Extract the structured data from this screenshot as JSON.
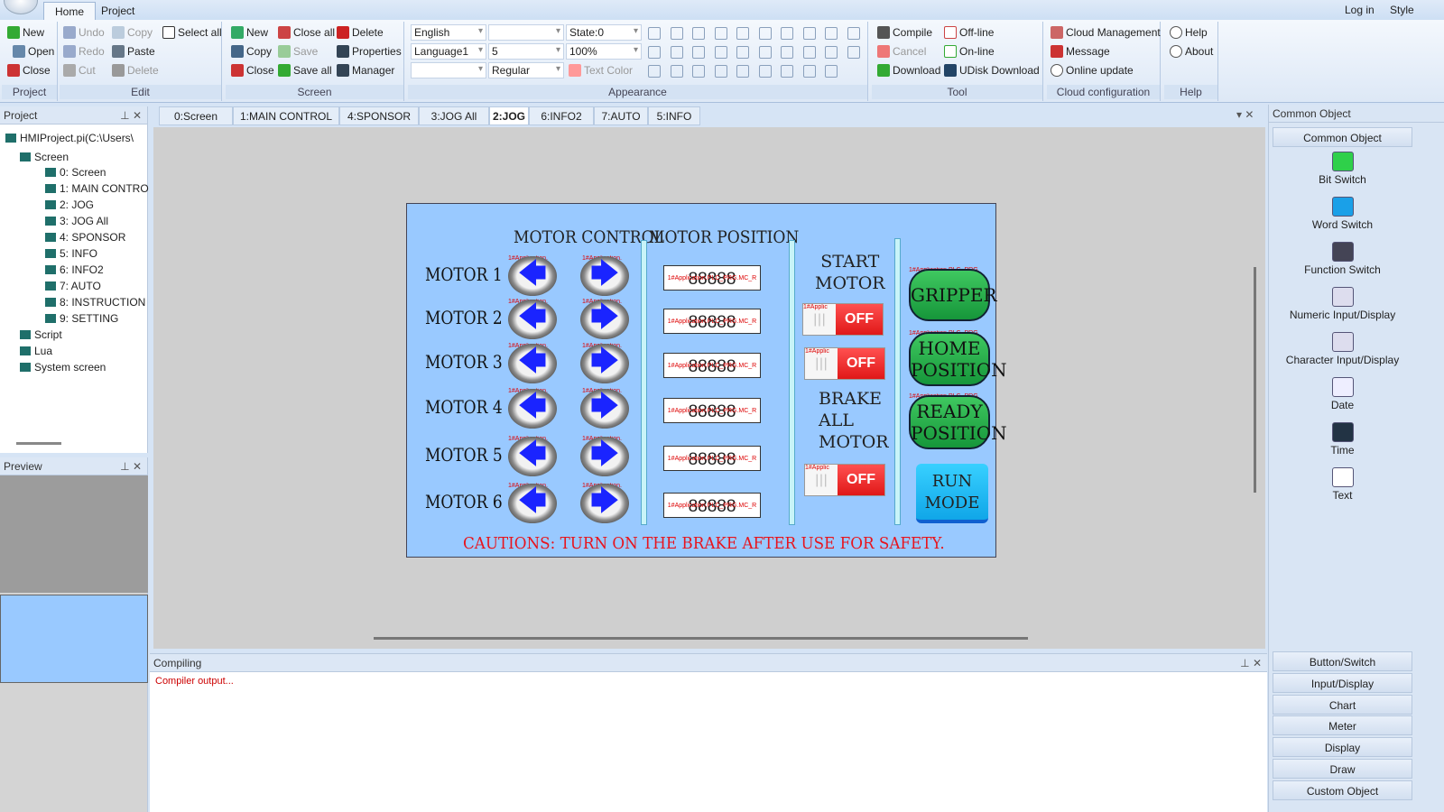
{
  "app": {
    "menu_tabs": [
      "Home",
      "Project"
    ],
    "right_links": [
      "Log in",
      "Style"
    ]
  },
  "ribbon": {
    "project": {
      "label": "Project",
      "items": [
        "New",
        "Open",
        "Close"
      ]
    },
    "edit": {
      "label": "Edit",
      "items": [
        "Undo",
        "Redo",
        "Cut",
        "Copy",
        "Paste",
        "Delete",
        "Select all"
      ]
    },
    "screen": {
      "label": "Screen",
      "items": [
        "New",
        "Copy",
        "Close",
        "Close all",
        "Save",
        "Save all",
        "Delete",
        "Properties",
        "Manager"
      ]
    },
    "appearance": {
      "label": "Appearance",
      "language": "English",
      "language_set": "Language1",
      "col2_row1": "",
      "font_size": "5",
      "font_style": "Regular",
      "state": "State:0",
      "zoom": "100%",
      "text_color": "Text Color"
    },
    "tool": {
      "label": "Tool",
      "items": [
        "Compile",
        "Cancel",
        "Download",
        "Off-line",
        "On-line",
        "UDisk Download"
      ]
    },
    "cloud": {
      "label": "Cloud configuration",
      "items": [
        "Cloud Management",
        "Message",
        "Online update"
      ]
    },
    "help": {
      "label": "Help",
      "items": [
        "Help",
        "About"
      ]
    }
  },
  "project_panel": {
    "title": "Project",
    "root": "HMIProject.pi(C:\\Users\\",
    "screen_folder": "Screen",
    "screens": [
      "0: Screen",
      "1: MAIN CONTRO",
      "2: JOG",
      "3: JOG All",
      "4: SPONSOR",
      "5: INFO",
      "6: INFO2",
      "7: AUTO",
      "8: INSTRUCTION",
      "9: SETTING"
    ],
    "others": [
      "Script",
      "Lua",
      "System screen"
    ]
  },
  "preview_panel": {
    "title": "Preview"
  },
  "doc_tabs": [
    "0:Screen",
    "1:MAIN CONTROL",
    "4:SPONSOR",
    "3:JOG All",
    "2:JOG",
    "6:INFO2",
    "7:AUTO",
    "5:INFO"
  ],
  "active_tab": "2:JOG",
  "hmi": {
    "header_control": "MOTOR CONTROL",
    "header_position": "MOTOR POSITION",
    "motors": [
      "MOTOR 1",
      "MOTOR 2",
      "MOTOR 3",
      "MOTOR 4",
      "MOTOR 5",
      "MOTOR 6"
    ],
    "arrow_tag": "1#Application.",
    "num_tag": "1#Application.PLC_PRG.MC_R",
    "num_value": "88888",
    "start_motor": [
      "START",
      "MOTOR"
    ],
    "brake_all": [
      "BRAKE",
      "ALL",
      "MOTOR"
    ],
    "toggle_tag": "1#Applic",
    "off": "OFF",
    "toggle_grip": "|||",
    "btn_tag": "1#Application.PLC_PRG.",
    "gripper": "GRIPPER",
    "home": [
      "HOME",
      "POSITION"
    ],
    "ready": [
      "READY",
      "POSITION"
    ],
    "run": [
      "RUN",
      "MODE"
    ],
    "caution": "CAUTIONS: TURN ON THE BRAKE AFTER USE FOR SAFETY."
  },
  "compiling": {
    "title": "Compiling",
    "output": "Compiler output..."
  },
  "common_object": {
    "title": "Common Object",
    "section": "Common Object",
    "items": [
      {
        "label": "Bit Switch",
        "color": "#2fd04a"
      },
      {
        "label": "Word Switch",
        "color": "#1aa0e8"
      },
      {
        "label": "Function Switch",
        "color": "#445"
      },
      {
        "label": "Numeric Input/Display",
        "color": "#dde"
      },
      {
        "label": "Character Input/Display",
        "color": "#dde"
      },
      {
        "label": "Date",
        "color": "#eef"
      },
      {
        "label": "Time",
        "color": "#234"
      },
      {
        "label": "Text",
        "color": "#fff"
      }
    ],
    "categories": [
      "Button/Switch",
      "Input/Display",
      "Chart",
      "Meter",
      "Display",
      "Draw",
      "Custom Object"
    ]
  }
}
